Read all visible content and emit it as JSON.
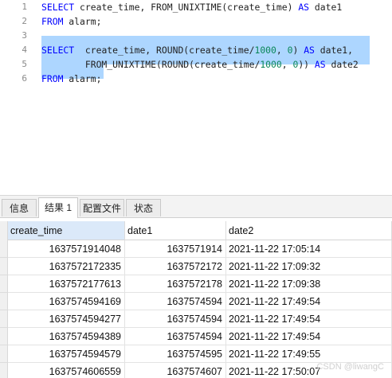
{
  "editor": {
    "lines": [
      {
        "number": "1",
        "tokens": [
          {
            "t": "SELECT",
            "c": "kw"
          },
          {
            "t": " create_time, FROM_UNIXTIME(create_time) ",
            "c": "id"
          },
          {
            "t": "AS",
            "c": "kw"
          },
          {
            "t": " date1",
            "c": "id"
          }
        ]
      },
      {
        "number": "2",
        "tokens": [
          {
            "t": "FROM",
            "c": "kw"
          },
          {
            "t": " alarm;",
            "c": "id"
          }
        ]
      },
      {
        "number": "3",
        "tokens": []
      },
      {
        "number": "4",
        "tokens": [
          {
            "t": "SELECT",
            "c": "kw"
          },
          {
            "t": "  create_time, ROUND(create_time/",
            "c": "id"
          },
          {
            "t": "1000",
            "c": "num"
          },
          {
            "t": ", ",
            "c": "id"
          },
          {
            "t": "0",
            "c": "num"
          },
          {
            "t": ") ",
            "c": "id"
          },
          {
            "t": "AS",
            "c": "kw"
          },
          {
            "t": " date1,",
            "c": "id"
          }
        ]
      },
      {
        "number": "5",
        "tokens": [
          {
            "t": "        FROM_UNIXTIME(ROUND(create_time/",
            "c": "id"
          },
          {
            "t": "1000",
            "c": "num"
          },
          {
            "t": ", ",
            "c": "id"
          },
          {
            "t": "0",
            "c": "num"
          },
          {
            "t": ")) ",
            "c": "id"
          },
          {
            "t": "AS",
            "c": "kw"
          },
          {
            "t": " date2",
            "c": "id"
          }
        ]
      },
      {
        "number": "6",
        "tokens": [
          {
            "t": "FROM",
            "c": "kw"
          },
          {
            "t": " alarm;",
            "c": "id"
          }
        ]
      }
    ]
  },
  "tabs": [
    "信息",
    "结果 1",
    "配置文件",
    "状态"
  ],
  "active_tab": "结果 1",
  "result": {
    "columns": [
      "create_time",
      "date1",
      "date2"
    ],
    "rows": [
      [
        "1637571914048",
        "1637571914",
        "2021-11-22 17:05:14"
      ],
      [
        "1637572172335",
        "1637572172",
        "2021-11-22 17:09:32"
      ],
      [
        "1637572177613",
        "1637572178",
        "2021-11-22 17:09:38"
      ],
      [
        "1637574594169",
        "1637574594",
        "2021-11-22 17:49:54"
      ],
      [
        "1637574594277",
        "1637574594",
        "2021-11-22 17:49:54"
      ],
      [
        "1637574594389",
        "1637574594",
        "2021-11-22 17:49:54"
      ],
      [
        "1637574594579",
        "1637574595",
        "2021-11-22 17:49:55"
      ],
      [
        "1637574606559",
        "1637574607",
        "2021-11-22 17:50:07"
      ]
    ]
  },
  "watermark": "CSDN @liwangC",
  "colors": {
    "keyword": "#0000ff",
    "number": "#098658",
    "selection": "#add6ff"
  }
}
